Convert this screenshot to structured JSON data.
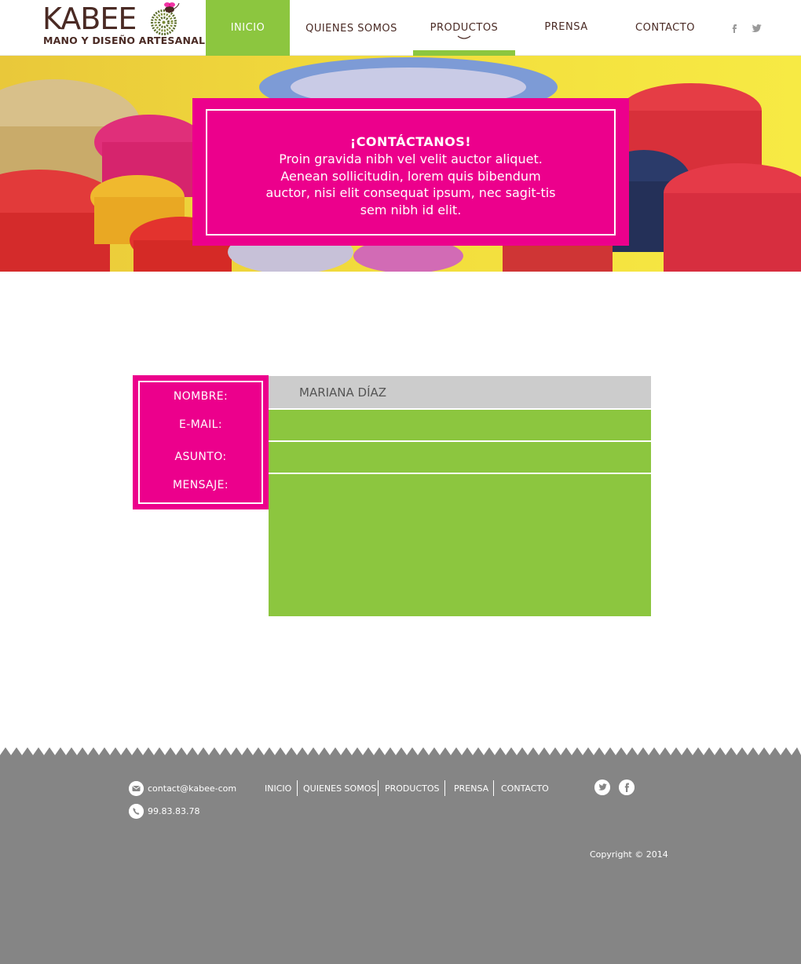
{
  "brand": {
    "name": "KABEE",
    "tagline": "MANO Y DISEÑO ARTESANAL",
    "colors": {
      "pink": "#ec008c",
      "green": "#8cc63f",
      "brown": "#4a2a24",
      "footer_gray": "#858585"
    }
  },
  "nav": {
    "items": [
      {
        "label": "INICIO",
        "state": "active"
      },
      {
        "label": "QUIENES SOMOS"
      },
      {
        "label": "PRODUCTOS",
        "state": "current",
        "icon": "chevron-down-icon"
      },
      {
        "label": "PRENSA"
      },
      {
        "label": "CONTACTO"
      }
    ],
    "social": [
      "facebook-icon",
      "twitter-icon"
    ]
  },
  "hero": {
    "title": "¡CONTÁCTANOS!",
    "text": "Proin gravida nibh vel velit auctor aliquet. Aenean sollicitudin, lorem quis bibendum auctor, nisi elit consequat ipsum, nec sagit-tis sem nibh id elit."
  },
  "form": {
    "labels": {
      "name": "NOMBRE:",
      "email": "E-MAIL:",
      "subject": "ASUNTO:",
      "message": "MENSAJE:"
    },
    "values": {
      "name": "MARIANA DÍAZ",
      "email": "",
      "subject": "",
      "message": ""
    }
  },
  "footer": {
    "email": "contact@kabee-com",
    "phone": "99.83.83.78",
    "nav": [
      "INICIO",
      "QUIENES SOMOS",
      "PRODUCTOS",
      "PRENSA",
      "CONTACTO"
    ],
    "social": [
      "twitter-icon",
      "facebook-icon"
    ],
    "copyright": "Copyright © 2014"
  }
}
